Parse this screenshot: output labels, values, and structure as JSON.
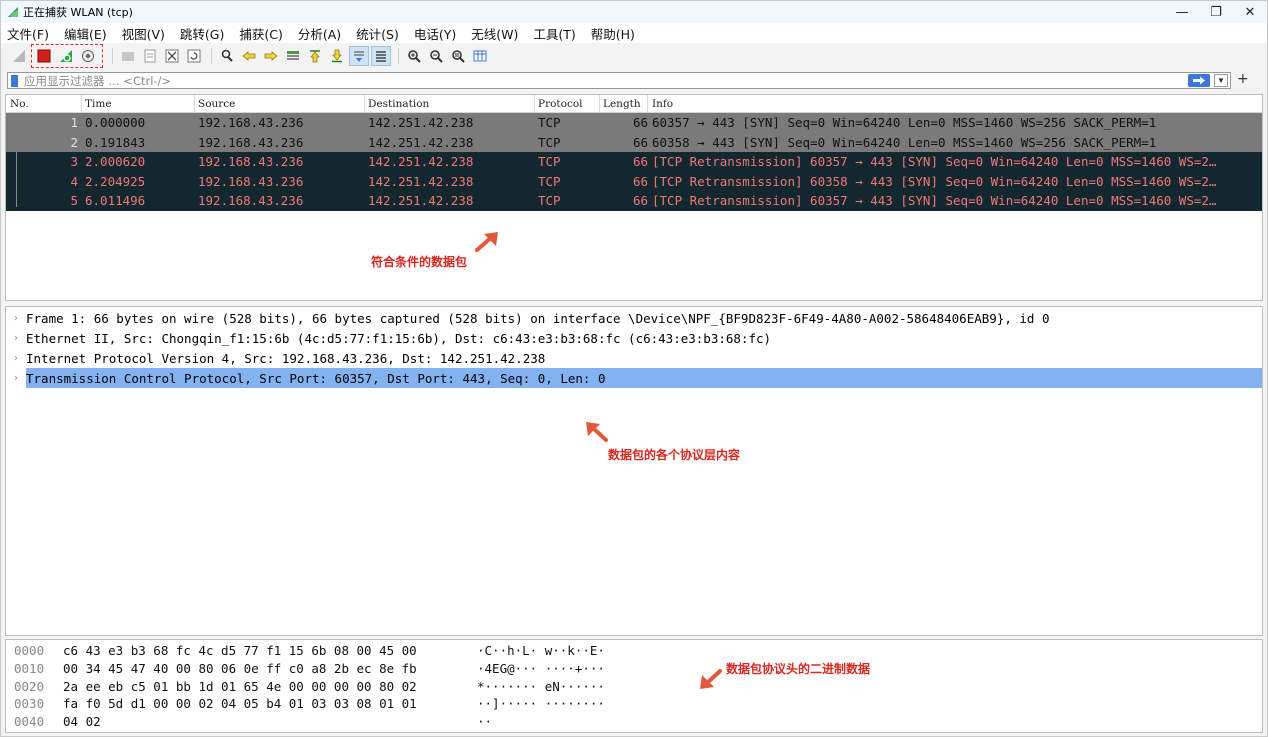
{
  "window": {
    "title": "正在捕获 WLAN (tcp)",
    "minimize": "—",
    "maximize": "❐",
    "close": "✕"
  },
  "menu": [
    "文件(F)",
    "编辑(E)",
    "视图(V)",
    "跳转(G)",
    "捕获(C)",
    "分析(A)",
    "统计(S)",
    "电话(Y)",
    "无线(W)",
    "工具(T)",
    "帮助(H)"
  ],
  "filter": {
    "placeholder": "应用显示过滤器 … <Ctrl-/>",
    "apply_icon": "arrow-right-icon",
    "plus": "+"
  },
  "packet_list": {
    "columns": [
      "No.",
      "Time",
      "Source",
      "Destination",
      "Protocol",
      "Length",
      "Info"
    ],
    "rows": [
      {
        "no": "1",
        "time": "0.000000",
        "src": "192.168.43.236",
        "dst": "142.251.42.238",
        "proto": "TCP",
        "len": "66",
        "info": "60357 → 443 [SYN] Seq=0 Win=64240 Len=0 MSS=1460 WS=256 SACK_PERM=1",
        "style": "gray"
      },
      {
        "no": "2",
        "time": "0.191843",
        "src": "192.168.43.236",
        "dst": "142.251.42.238",
        "proto": "TCP",
        "len": "66",
        "info": "60358 → 443 [SYN] Seq=0 Win=64240 Len=0 MSS=1460 WS=256 SACK_PERM=1",
        "style": "gray"
      },
      {
        "no": "3",
        "time": "2.000620",
        "src": "192.168.43.236",
        "dst": "142.251.42.238",
        "proto": "TCP",
        "len": "66",
        "info": "[TCP Retransmission] 60357 → 443 [SYN] Seq=0 Win=64240 Len=0 MSS=1460 WS=2…",
        "style": "dark"
      },
      {
        "no": "4",
        "time": "2.204925",
        "src": "192.168.43.236",
        "dst": "142.251.42.238",
        "proto": "TCP",
        "len": "66",
        "info": "[TCP Retransmission] 60358 → 443 [SYN] Seq=0 Win=64240 Len=0 MSS=1460 WS=2…",
        "style": "dark"
      },
      {
        "no": "5",
        "time": "6.011496",
        "src": "192.168.43.236",
        "dst": "142.251.42.238",
        "proto": "TCP",
        "len": "66",
        "info": "[TCP Retransmission] 60357 → 443 [SYN] Seq=0 Win=64240 Len=0 MSS=1460 WS=2…",
        "style": "dark"
      }
    ]
  },
  "annotations": {
    "packets": "符合条件的数据包",
    "layers": "数据包的各个协议层内容",
    "bytes": "数据包协议头的二进制数据"
  },
  "details": [
    {
      "text": "Frame 1: 66 bytes on wire (528 bits), 66 bytes captured (528 bits) on interface \\Device\\NPF_{BF9D823F-6F49-4A80-A002-58648406EAB9}, id 0",
      "selected": false
    },
    {
      "text": "Ethernet II, Src: Chongqin_f1:15:6b (4c:d5:77:f1:15:6b), Dst: c6:43:e3:b3:68:fc (c6:43:e3:b3:68:fc)",
      "selected": false
    },
    {
      "text": "Internet Protocol Version 4, Src: 192.168.43.236, Dst: 142.251.42.238",
      "selected": false
    },
    {
      "text": "Transmission Control Protocol, Src Port: 60357, Dst Port: 443, Seq: 0, Len: 0",
      "selected": true
    }
  ],
  "bytes": [
    {
      "offset": "0000",
      "hex": "c6 43 e3 b3 68 fc 4c d5  77 f1 15 6b 08 00 45 00",
      "ascii": "·C··h·L· w··k··E·"
    },
    {
      "offset": "0010",
      "hex": "00 34 45 47 40 00 80 06  0e ff c0 a8 2b ec 8e fb",
      "ascii": "·4EG@··· ····+···"
    },
    {
      "offset": "0020",
      "hex": "2a ee eb c5 01 bb 1d 01  65 4e 00 00 00 00 80 02",
      "ascii": "*······· eN······"
    },
    {
      "offset": "0030",
      "hex": "fa f0 5d d1 00 00 02 04  05 b4 01 03 03 08 01 01",
      "ascii": "··]····· ········"
    },
    {
      "offset": "0040",
      "hex": "04 02",
      "ascii": "··"
    }
  ],
  "colors": {
    "accent": "#3b78d8",
    "annotation": "#d8281f",
    "row_gray": "#7a7a7a",
    "row_dark": "#12272e",
    "row_dark_text": "#f07878",
    "selection": "#82b3f0"
  }
}
